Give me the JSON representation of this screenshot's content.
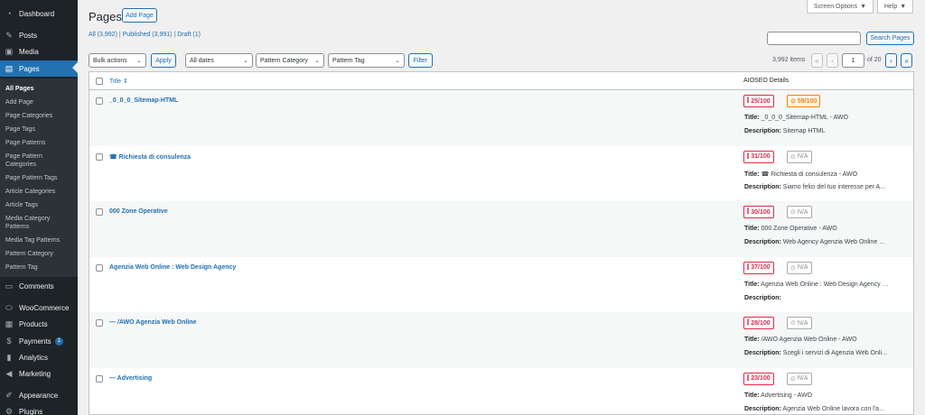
{
  "sidebar": {
    "items": [
      {
        "label": "Dashboard",
        "icon": "dashboard-icon",
        "glyph": "◔"
      },
      {
        "label": "Posts",
        "icon": "pin-icon",
        "glyph": "✎"
      },
      {
        "label": "Media",
        "icon": "media-icon",
        "glyph": "▣"
      },
      {
        "label": "Pages",
        "icon": "pages-icon",
        "glyph": "▤"
      },
      {
        "label": "Comments",
        "icon": "comments-icon",
        "glyph": "▭"
      },
      {
        "label": "WooCommerce",
        "icon": "woocommerce-icon",
        "glyph": "⬭"
      },
      {
        "label": "Products",
        "icon": "products-icon",
        "glyph": "▦"
      },
      {
        "label": "Payments",
        "icon": "payments-icon",
        "glyph": "$",
        "badge": "1"
      },
      {
        "label": "Analytics",
        "icon": "analytics-icon",
        "glyph": "▮"
      },
      {
        "label": "Marketing",
        "icon": "marketing-icon",
        "glyph": "◀"
      },
      {
        "label": "Appearance",
        "icon": "appearance-icon",
        "glyph": "✐"
      },
      {
        "label": "Plugins",
        "icon": "plugins-icon",
        "glyph": "⚙"
      }
    ],
    "pages_submenu": [
      "All Pages",
      "Add Page",
      "Page Categories",
      "Page Tags",
      "Page Patterns",
      "Page Pattern Categories",
      "Page Pattern Tags",
      "Article Categories",
      "Article Tags",
      "Media Category Patterns",
      "Media Tag Patterns",
      "Pattern Category",
      "Pattern Tag"
    ]
  },
  "header": {
    "title": "Pages",
    "add_page": "Add Page",
    "screen_options": "Screen Options",
    "help": "Help"
  },
  "views": {
    "all": "All (3,992)",
    "published": "Published (3,991)",
    "draft": "Draft (1)",
    "sep": "|"
  },
  "search": {
    "button": "Search Pages",
    "value": ""
  },
  "filters": {
    "bulk_actions": "Bulk actions",
    "apply": "Apply",
    "dates": "All dates",
    "pattern_category": "Pattern Category",
    "pattern_tag": "Pattern Tag",
    "filter": "Filter"
  },
  "pagination": {
    "items": "3,992 items",
    "current_page": "1",
    "of_pages": "of 20",
    "first": "«",
    "prev": "‹",
    "next": "›",
    "last": "»"
  },
  "table": {
    "col_title": "Title",
    "col_aioseo": "AIOSEO Details",
    "title_label": "Title:",
    "desc_label": "Description:",
    "rows": [
      {
        "title": "_0_0_0_Sitemap-HTML",
        "score": "25/100",
        "truseo": "59/100",
        "seo_title": "_0_0_0_Sitemap-HTML - AWO",
        "description": "Sitemap HTML"
      },
      {
        "title": "☎ Richiesta di consulenza",
        "score": "31/100",
        "truseo": "N/A",
        "seo_title": "☎ Richiesta di consulenza - AWO",
        "description": "Siamo felici del tuo interesse per A…"
      },
      {
        "title": "000 Zone Operative",
        "score": "30/100",
        "truseo": "N/A",
        "seo_title": "000 Zone Operative - AWO",
        "description": "Web Agency Agenzia Web Online …"
      },
      {
        "title": "Agenzia Web Online : Web Design Agency",
        "score": "37/100",
        "truseo": "N/A",
        "seo_title": "Agenzia Web Online : Web Design Agency …",
        "description": ""
      },
      {
        "title": "— /AWO Agenzia Web Online",
        "score": "28/100",
        "truseo": "N/A",
        "seo_title": "/AWO Agenzia Web Online - AWO",
        "description": "Scegli i servizi di Agenzia Web Onli…"
      },
      {
        "title": "— Advertising",
        "score": "23/100",
        "truseo": "N/A",
        "seo_title": "Advertising - AWO",
        "description": "Agenzia Web Online lavora con l'a…"
      }
    ]
  },
  "colors": {
    "sidebar_bg": "#1d2327",
    "accent": "#2271b1",
    "score_bad": "#df2a4a",
    "score_ok": "#f18200"
  }
}
